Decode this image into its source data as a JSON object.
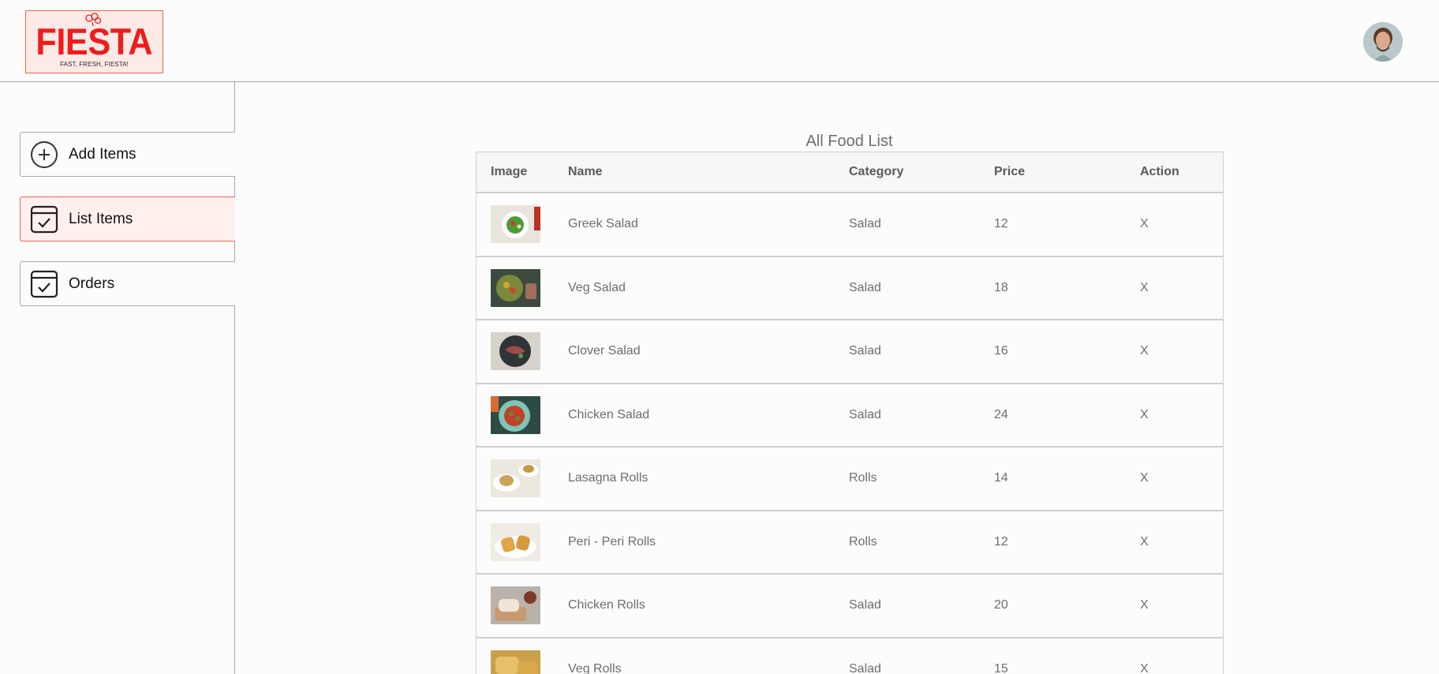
{
  "brand": {
    "name": "FIESTA",
    "tagline": "FAST, FRESH, FIESTA!"
  },
  "sidebar": {
    "items": [
      {
        "label": "Add Items",
        "icon": "add-circle-icon"
      },
      {
        "label": "List Items",
        "icon": "calendar-check-icon",
        "active": true
      },
      {
        "label": "Orders",
        "icon": "calendar-check-icon"
      }
    ]
  },
  "main": {
    "title": "All Food List",
    "columns": [
      "Image",
      "Name",
      "Category",
      "Price",
      "Action"
    ],
    "rows": [
      {
        "name": "Greek Salad",
        "category": "Salad",
        "price": "12",
        "action": "X"
      },
      {
        "name": "Veg Salad",
        "category": "Salad",
        "price": "18",
        "action": "X"
      },
      {
        "name": "Clover Salad",
        "category": "Salad",
        "price": "16",
        "action": "X"
      },
      {
        "name": "Chicken Salad",
        "category": "Salad",
        "price": "24",
        "action": "X"
      },
      {
        "name": "Lasagna Rolls",
        "category": "Rolls",
        "price": "14",
        "action": "X"
      },
      {
        "name": "Peri - Peri Rolls",
        "category": "Rolls",
        "price": "12",
        "action": "X"
      },
      {
        "name": "Chicken Rolls",
        "category": "Salad",
        "price": "20",
        "action": "X"
      },
      {
        "name": "Veg Rolls",
        "category": "Salad",
        "price": "15",
        "action": "X"
      }
    ]
  },
  "colors": {
    "accent": "#e8674f",
    "brand_red": "#ef1c1c",
    "active_bg": "#fff0ee"
  }
}
